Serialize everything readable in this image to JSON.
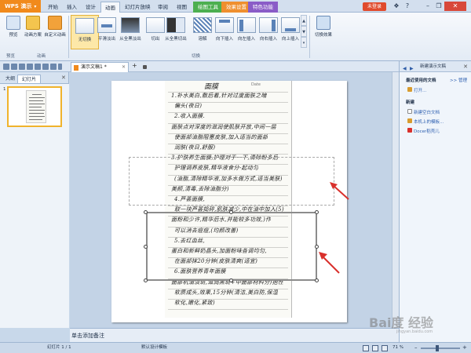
{
  "app": {
    "name": "WPS 演示",
    "login": "未登录"
  },
  "menu": {
    "tabs": [
      "开始",
      "插入",
      "设计",
      "动画",
      "幻灯片放映",
      "审阅",
      "视图"
    ],
    "active": "动画",
    "context_tabs": [
      "绘图工具",
      "效果设置",
      "特色功能"
    ]
  },
  "colors": {
    "app_orange": "#f18a1c",
    "context_green": "#4caf50",
    "context_orange": "#ef8f2e",
    "context_purple": "#8a5cc7",
    "selection_gold": "#f0b32c",
    "arrow_red": "#d9302c"
  },
  "ribbon": {
    "preview": "预览",
    "anim_scheme": "动画方案",
    "custom_anim": "自定义动画",
    "transitions": [
      "无切换",
      "平滑淡出",
      "从全黑淡出",
      "切出",
      "从全黑切出",
      "溶解",
      "向下插入",
      "向左插入",
      "向右插入",
      "向上插入"
    ],
    "switch_effect": "切换效果",
    "group_preview": "预览",
    "group_anim": "动画",
    "group_switch": "切换"
  },
  "doc": {
    "tab_name": "演示文稿1 *"
  },
  "left_panel": {
    "tabs": [
      "大纲",
      "幻灯片"
    ],
    "active": "幻灯片",
    "slide_number": "1"
  },
  "slide": {
    "title": "面膜",
    "date_hint": "Date",
    "lines": [
      "1.补水美白,敷后着,针对过度面肤之暗",
      "偏头(夜日)",
      "2.收入面膜.",
      "面肤点对深度的滋润使肌肤开放,中间一层",
      "使面部油脂阻塞皮肤,加入适当的面部",
      "润肤(夜日,舒服)",
      "3.护肤养生面膜,护理对于一下,清除粉多后",
      "护理调养皮肤,精华液食分-起动匀",
      "(油脂,清除精华液,加多水做方式,适当美肤)",
      "美颜,清毒,去除油脂分)",
      "4.芦荟面膜,",
      "取一块芦荟捣碎,肌肤减少,中在油中加入(5)",
      "面粉和少许,精华后水,并能较多功效,)作",
      "可以消去痘痘,(均颜改善)",
      "5.去红血丝,",
      "蛋白和新鲜奶晶头,加面粉味各调均匀,",
      "在面部抹20分钟(皮肤清爽(适宜)",
      "6.面肤营养青年面膜",
      "面部机油淡斑,滋润黑斑+中面部材料分)抱性",
      "软质成头,效果,15分钟(清洁,美白防,保湿",
      "软化,嫩化,紧致)"
    ]
  },
  "notes": {
    "placeholder": "单击添加备注"
  },
  "task_pane": {
    "title": "新建演示文稿",
    "recent_heading": "最近使用的文档",
    "manage": ">> 管理",
    "open": "打开...",
    "new_heading": "新建",
    "new_blank": "新建空白文档",
    "from_template": "本机上的模板...",
    "docer": "Docer稻壳儿"
  },
  "status": {
    "slide_info": "幻灯片 1 / 1",
    "template": "默认设计模板",
    "zoom": "71 %"
  },
  "watermark": {
    "text": "Bai度 经验",
    "sub": "jingyan.baidu.com"
  }
}
